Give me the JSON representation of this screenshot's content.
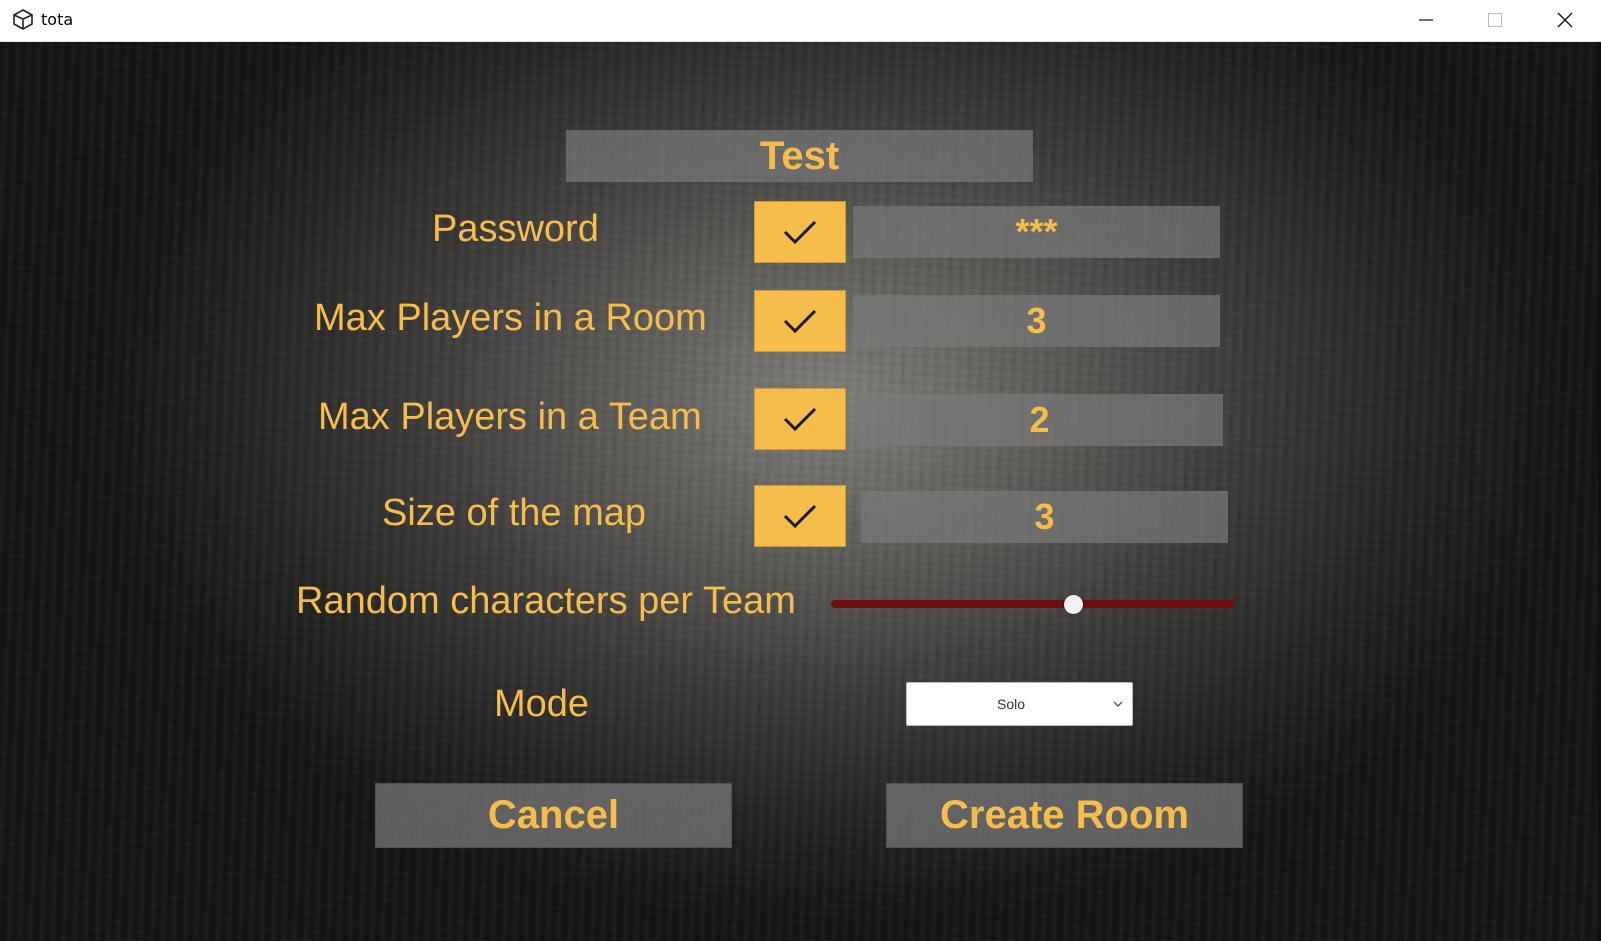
{
  "window": {
    "title": "tota",
    "icon": "unity-icon",
    "controls": [
      "minimize-icon",
      "maximize-icon",
      "close-icon"
    ]
  },
  "colors": {
    "accent": "#f6bd4c",
    "slider_track": "#6e0d0d",
    "field_bg": "#787878"
  },
  "form": {
    "room_name": "Test",
    "rows": [
      {
        "label": "Password",
        "checked": true,
        "value": "***"
      },
      {
        "label": "Max Players in a Room",
        "checked": true,
        "value": "3"
      },
      {
        "label": "Max Players in a Team",
        "checked": true,
        "value": "2"
      },
      {
        "label": "Size of the map",
        "checked": true,
        "value": "3"
      }
    ],
    "random_characters": {
      "label": "Random characters per Team",
      "level": 0.6
    },
    "mode": {
      "label": "Mode",
      "selected": "Solo"
    }
  },
  "buttons": {
    "cancel": "Cancel",
    "create": "Create Room"
  }
}
